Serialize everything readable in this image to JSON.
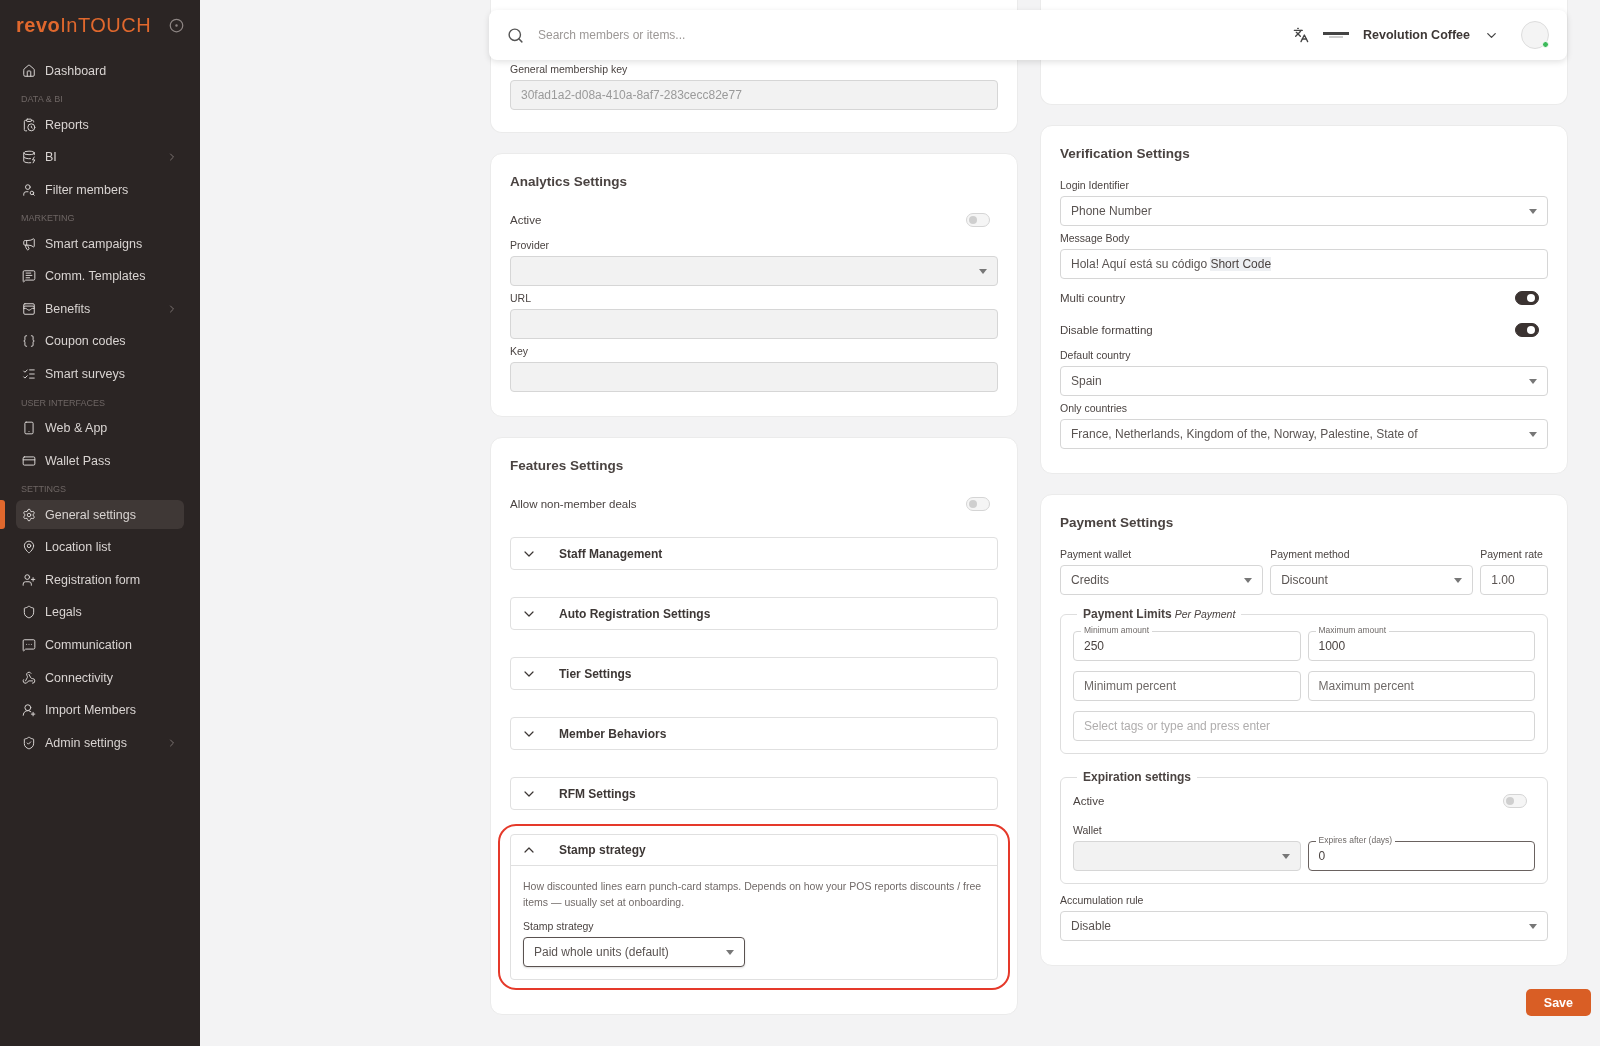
{
  "sidebar": {
    "logo": {
      "primary": "revo",
      "secondary": "InTOUCH"
    },
    "sections": [
      {
        "items": [
          {
            "label": "Dashboard",
            "selected": false,
            "submenu": false
          }
        ]
      },
      {
        "title": "DATA & BI",
        "items": [
          {
            "label": "Reports",
            "selected": false,
            "submenu": false
          },
          {
            "label": "BI",
            "selected": false,
            "submenu": true
          },
          {
            "label": "Filter members",
            "selected": false,
            "submenu": false
          }
        ]
      },
      {
        "title": "MARKETING",
        "items": [
          {
            "label": "Smart campaigns",
            "selected": false,
            "submenu": false
          },
          {
            "label": "Comm. Templates",
            "selected": false,
            "submenu": false
          },
          {
            "label": "Benefits",
            "selected": false,
            "submenu": true
          },
          {
            "label": "Coupon codes",
            "selected": false,
            "submenu": false
          },
          {
            "label": "Smart surveys",
            "selected": false,
            "submenu": false
          }
        ]
      },
      {
        "title": "USER INTERFACES",
        "items": [
          {
            "label": "Web & App",
            "selected": false,
            "submenu": false
          },
          {
            "label": "Wallet Pass",
            "selected": false,
            "submenu": false
          }
        ]
      },
      {
        "title": "SETTINGS",
        "items": [
          {
            "label": "General settings",
            "selected": true,
            "submenu": false
          },
          {
            "label": "Location list",
            "selected": false,
            "submenu": false
          },
          {
            "label": "Registration form",
            "selected": false,
            "submenu": false
          },
          {
            "label": "Legals",
            "selected": false,
            "submenu": false
          },
          {
            "label": "Communication",
            "selected": false,
            "submenu": false
          },
          {
            "label": "Connectivity",
            "selected": false,
            "submenu": false
          },
          {
            "label": "Import Members",
            "selected": false,
            "submenu": false
          },
          {
            "label": "Admin settings",
            "selected": false,
            "submenu": true
          }
        ]
      }
    ]
  },
  "header": {
    "search": {
      "placeholder": "Search members or items..."
    },
    "account": "Revolution Coffee",
    "online": true
  },
  "left_column": [
    {
      "rows": [
        {
          "kind": "input",
          "label": "General membership key",
          "value": "30fad1a2-d08a-410a-8af7-283cecc82e77",
          "disabled": true
        }
      ]
    },
    {
      "title": "Analytics Settings",
      "rows": [
        {
          "kind": "toggle",
          "label": "Active",
          "on": false
        },
        {
          "kind": "select",
          "label": "Provider",
          "disabled": true
        },
        {
          "kind": "input",
          "label": "URL",
          "disabled": true
        },
        {
          "kind": "input",
          "label": "Key",
          "disabled": true
        }
      ]
    },
    {
      "title": "Features Settings",
      "rows": [
        {
          "kind": "toggle",
          "label": "Allow non-member deals",
          "on": false
        },
        {
          "kind": "accordion",
          "label": "Staff Management",
          "expanded": false,
          "highlighted": false
        },
        {
          "kind": "accordion",
          "label": "Auto Registration Settings",
          "expanded": false,
          "highlighted": false
        },
        {
          "kind": "accordion",
          "label": "Tier Settings",
          "expanded": false,
          "highlighted": false
        },
        {
          "kind": "accordion",
          "label": "Member Behaviors",
          "expanded": false,
          "highlighted": false
        },
        {
          "kind": "accordion",
          "label": "RFM Settings",
          "expanded": false,
          "highlighted": false
        },
        {
          "kind": "accordion",
          "label": "Stamp strategy",
          "expanded": true,
          "highlighted": true,
          "description": "How discounted lines earn punch-card stamps. Depends on how your POS reports discounts / free items — usually set at onboarding.",
          "field": {
            "kind": "select",
            "label": "Stamp strategy",
            "value": "Paid whole units (default)",
            "focused": true
          }
        }
      ]
    }
  ],
  "right_column": [
    {
      "title": "Verification Settings",
      "rows": [
        {
          "kind": "select",
          "label": "Login Identifier",
          "value": "Phone Number"
        },
        {
          "kind": "input",
          "label": "Message Body",
          "value": "Hola! Aquí está su código ",
          "token": "Short Code"
        },
        {
          "kind": "toggle",
          "label": "Multi country",
          "on": true
        },
        {
          "kind": "toggle",
          "label": "Disable formatting",
          "on": true
        },
        {
          "kind": "select",
          "label": "Default country",
          "value": "Spain"
        },
        {
          "kind": "select",
          "label": "Only countries",
          "value": "France, Netherlands, Kingdom of the, Norway, Palestine, State of"
        }
      ]
    },
    {
      "title": "Payment Settings",
      "rows": [
        {
          "kind": "field-row",
          "fields": [
            {
              "kind": "select",
              "label": "Payment wallet",
              "value": "Credits"
            },
            {
              "kind": "select",
              "label": "Payment method",
              "value": "Discount"
            },
            {
              "kind": "input",
              "label": "Payment rate",
              "value": "1.00"
            }
          ]
        },
        {
          "kind": "group",
          "legend": "Payment Limits",
          "note": "Per Payment",
          "rows": [
            {
              "kind": "field-row",
              "fields": [
                {
                  "kind": "floating",
                  "label": "Minimum amount",
                  "value": "250"
                },
                {
                  "kind": "floating",
                  "label": "Maximum amount",
                  "value": "1000"
                }
              ]
            },
            {
              "kind": "field-row",
              "fields": [
                {
                  "kind": "input",
                  "placeholder": "Minimum percent"
                },
                {
                  "kind": "input",
                  "placeholder": "Maximum percent"
                }
              ]
            },
            {
              "kind": "tags",
              "placeholder": "Select tags or type and press enter"
            }
          ]
        },
        {
          "kind": "group",
          "legend": "Expiration settings",
          "rows": [
            {
              "kind": "toggle",
              "label": "Active",
              "on": false
            },
            {
              "kind": "field-row",
              "fields": [
                {
                  "kind": "select",
                  "label": "Wallet",
                  "disabled": true
                },
                {
                  "kind": "floating",
                  "label": "Expires after (days)",
                  "value": "0",
                  "focused": true
                }
              ]
            }
          ]
        },
        {
          "kind": "select",
          "label": "Accumulation rule",
          "value": "Disable"
        }
      ]
    }
  ],
  "save_button": "Save"
}
